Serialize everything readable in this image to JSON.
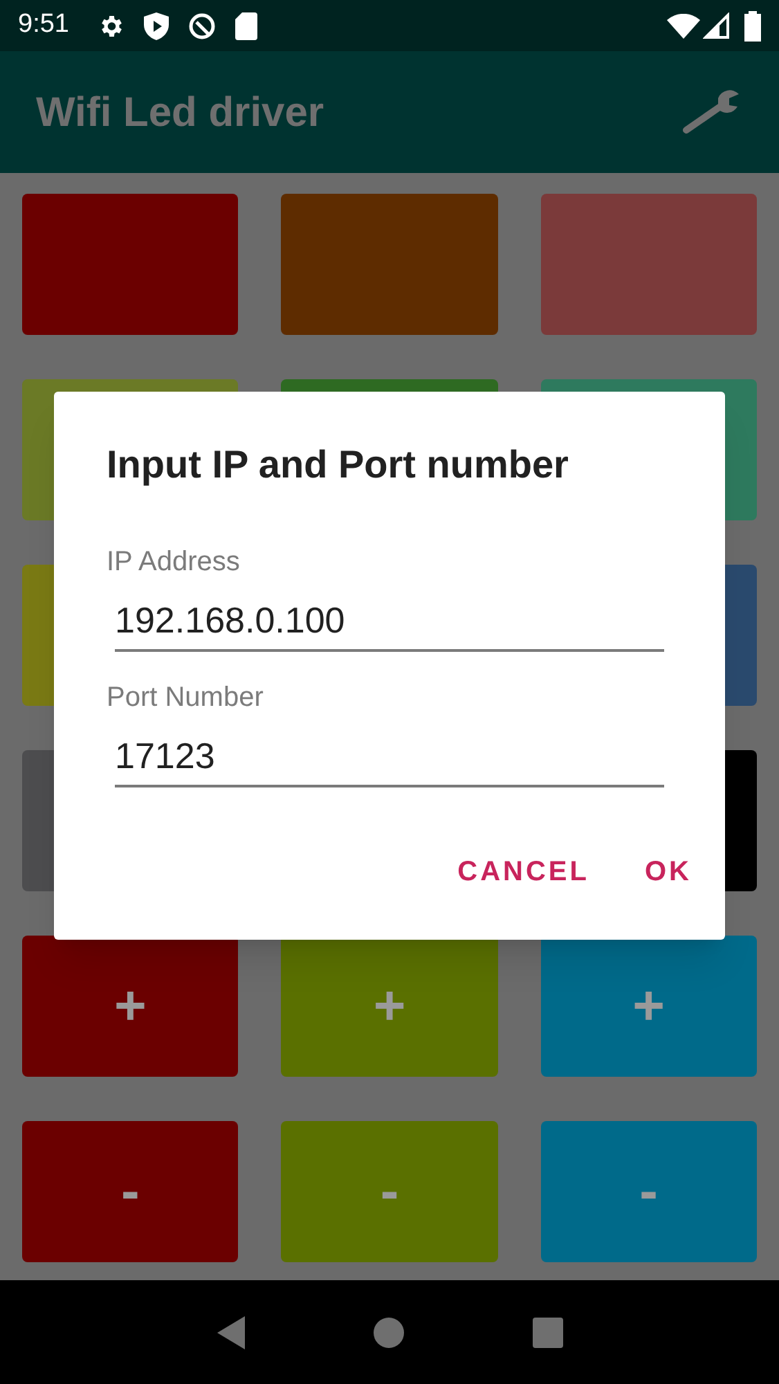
{
  "status_bar": {
    "time": "9:51"
  },
  "toolbar": {
    "title": "Wifi Led driver"
  },
  "tiles": [
    {
      "kind": "tile",
      "color": "#6b0000"
    },
    {
      "kind": "tile",
      "color": "#5e2c00"
    },
    {
      "kind": "tile",
      "color": "#7b3a3a"
    },
    {
      "kind": "tile",
      "color": "#6b7a26"
    },
    {
      "kind": "tile",
      "color": "#2e6a22"
    },
    {
      "kind": "tile",
      "color": "#2e7a5e"
    },
    {
      "kind": "tile",
      "color": "#7a7a14"
    },
    {
      "kind": "hidden"
    },
    {
      "kind": "tile",
      "color": "#2a4a6e"
    },
    {
      "kind": "tile",
      "color": "#4d4d4f"
    },
    {
      "kind": "hidden"
    },
    {
      "kind": "tile",
      "color": "#000000"
    },
    {
      "kind": "tile",
      "color": "#6b0000",
      "label": "+"
    },
    {
      "kind": "tile",
      "color": "#5a7000",
      "label": "+"
    },
    {
      "kind": "tile",
      "color": "#006a8a",
      "label": "+"
    },
    {
      "kind": "tile",
      "color": "#6b0000",
      "label": "-"
    },
    {
      "kind": "tile",
      "color": "#5a7000",
      "label": "-"
    },
    {
      "kind": "tile",
      "color": "#006a8a",
      "label": "-"
    }
  ],
  "dialog": {
    "title": "Input IP and Port number",
    "fields": [
      {
        "label": "IP Address",
        "value": "192.168.0.100"
      },
      {
        "label": "Port Number",
        "value": "17123"
      }
    ],
    "buttons": [
      "CANCEL",
      "OK"
    ]
  }
}
